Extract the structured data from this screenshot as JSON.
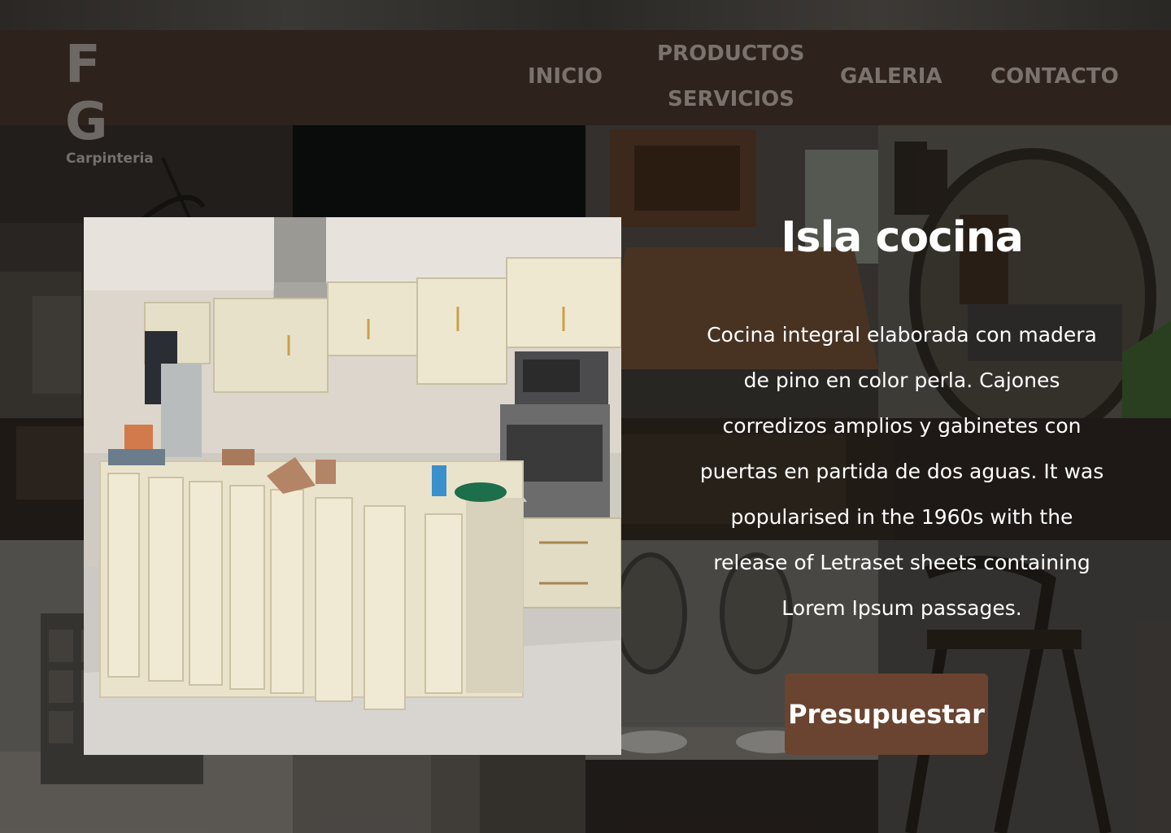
{
  "brand": {
    "mark": "F G",
    "tagline": "Carpinteria"
  },
  "nav": {
    "inicio": "INICIO",
    "productos": "PRODUCTOS",
    "servicios": "SERVICIOS",
    "galeria": "GALERIA",
    "contacto": "CONTACTO"
  },
  "product": {
    "title": "Isla cocina",
    "description": "Cocina integral elaborada con  madera de pino en color perla. Cajones corredizos amplios y gabinetes con puertas en partida de dos aguas.  It was popularised in the 1960s with the release of Letraset sheets containing Lorem Ipsum passages.",
    "cta_label": "Presupuestar"
  },
  "colors": {
    "header_bg": "#2d221c",
    "nav_text": "#7a736d",
    "cta_bg": "#6a4430",
    "text": "#ffffff"
  }
}
